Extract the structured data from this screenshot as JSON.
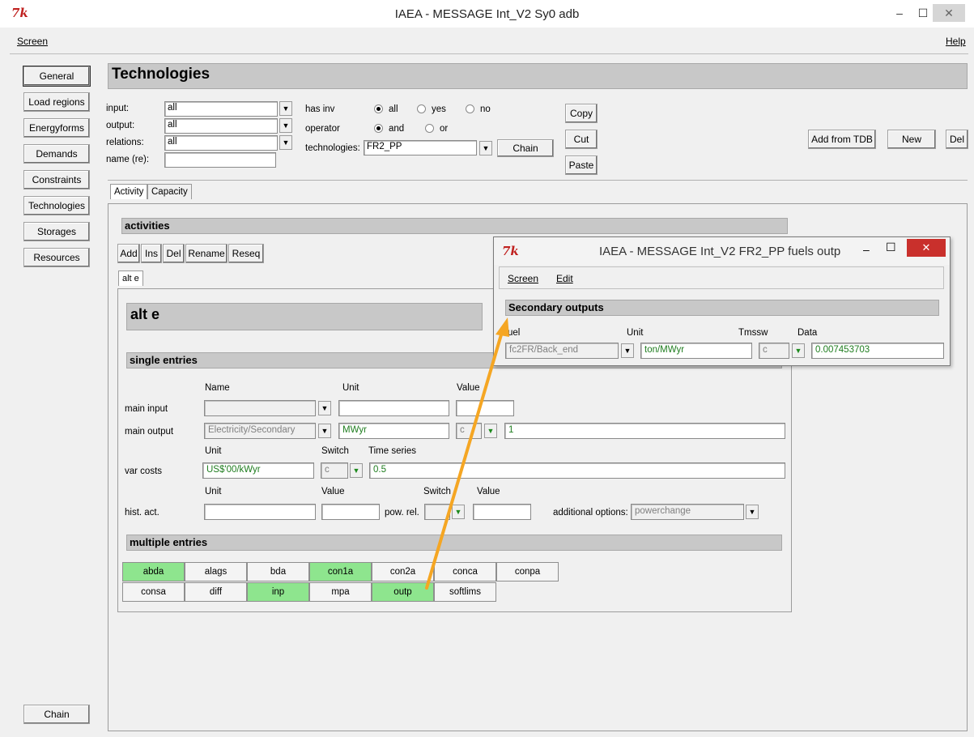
{
  "window": {
    "title": "IAEA - MESSAGE Int_V2 Sy0 adb",
    "minimize": "–",
    "maximize": "☐",
    "close": "✕"
  },
  "menu": {
    "screen": "Screen",
    "help": "Help"
  },
  "sidebar": {
    "items": [
      "General",
      "Load regions",
      "Energyforms",
      "Demands",
      "Constraints",
      "Technologies",
      "Storages",
      "Resources"
    ],
    "chain": "Chain"
  },
  "page_title": "Technologies",
  "filters": {
    "input_label": "input:",
    "input_value": "all",
    "output_label": "output:",
    "output_value": "all",
    "relations_label": "relations:",
    "relations_value": "all",
    "name_label": "name (re):",
    "name_value": "",
    "has_inv_label": "has inv",
    "has_inv_options": [
      "all",
      "yes",
      "no"
    ],
    "has_inv_selected": "all",
    "operator_label": "operator",
    "operator_options": [
      "and",
      "or"
    ],
    "operator_selected": "and",
    "technologies_label": "technologies:",
    "technologies_value": "FR2_PP",
    "chain_button": "Chain"
  },
  "edit_buttons": {
    "copy": "Copy",
    "cut": "Cut",
    "paste": "Paste"
  },
  "right_buttons": {
    "add_from_tdb": "Add from TDB",
    "new": "New",
    "del": "Del"
  },
  "tabs": [
    "Activity",
    "Capacity"
  ],
  "activities": {
    "header": "activities",
    "buttons": [
      "Add",
      "Ins",
      "Del",
      "Rename",
      "Reseq"
    ],
    "subtab": "alt e",
    "name": "alt e"
  },
  "single_entries": {
    "header": "single entries",
    "col_name": "Name",
    "col_unit": "Unit",
    "col_value": "Value",
    "main_input_label": "main input",
    "main_input_name": "",
    "main_input_unit": "",
    "main_input_value": "",
    "main_output_label": "main output",
    "main_output_name": "Electricity/Secondary",
    "main_output_unit": "MWyr",
    "main_output_switch": "c",
    "main_output_value": "1",
    "var_unit_label": "Unit",
    "var_switch_label": "Switch",
    "var_ts_label": "Time series",
    "var_costs_label": "var costs",
    "var_costs_unit": "US$'00/kWyr",
    "var_costs_switch": "c",
    "var_costs_value": "0.5",
    "hist_unit_label": "Unit",
    "hist_value_label": "Value",
    "hist_switch_label": "Switch",
    "hist_value2_label": "Value",
    "hist_act_label": "hist. act.",
    "hist_act_unit": "",
    "hist_act_value": "",
    "pow_rel_label": "pow. rel.",
    "pow_rel_value": "",
    "additional_options_label": "additional options:",
    "additional_options_value": "powerchange"
  },
  "multiple_entries": {
    "header": "multiple entries",
    "row1": [
      {
        "label": "abda",
        "highlight": true
      },
      {
        "label": "alags",
        "highlight": false
      },
      {
        "label": "bda",
        "highlight": false
      },
      {
        "label": "con1a",
        "highlight": true
      },
      {
        "label": "con2a",
        "highlight": false
      },
      {
        "label": "conca",
        "highlight": false
      },
      {
        "label": "conpa",
        "highlight": false
      }
    ],
    "row2": [
      {
        "label": "consa",
        "highlight": false
      },
      {
        "label": "diff",
        "highlight": false
      },
      {
        "label": "inp",
        "highlight": true
      },
      {
        "label": "mpa",
        "highlight": false
      },
      {
        "label": "outp",
        "highlight": true
      },
      {
        "label": "softlims",
        "highlight": false
      }
    ]
  },
  "popup": {
    "title": "IAEA - MESSAGE Int_V2 FR2_PP fuels outp",
    "menu_screen": "Screen",
    "menu_edit": "Edit",
    "header": "Secondary outputs",
    "col_fuel": "uel",
    "col_unit": "Unit",
    "col_tmssw": "Tmssw",
    "col_data": "Data",
    "fuel_value": "fc2FR/Back_end",
    "unit_value": "ton/MWyr",
    "tmssw_value": "c",
    "data_value": "0.007453703"
  },
  "colors": {
    "highlight_green": "#8ee58e",
    "arrow_orange": "#f5a623",
    "close_red": "#c9302c"
  }
}
